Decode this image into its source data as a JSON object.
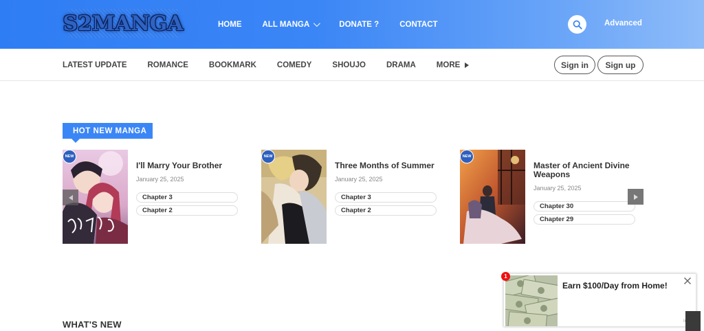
{
  "header": {
    "logo_text": "S2MANGA",
    "nav": [
      {
        "label": "HOME"
      },
      {
        "label": "ALL MANGA",
        "has_dropdown": true
      },
      {
        "label": "DONATE ?"
      },
      {
        "label": "CONTACT"
      }
    ],
    "advanced_label": "Advanced",
    "search_icon": "search-icon"
  },
  "subnav": {
    "items": [
      {
        "label": "LATEST UPDATE"
      },
      {
        "label": "ROMANCE"
      },
      {
        "label": "BOOKMARK"
      },
      {
        "label": "COMEDY"
      },
      {
        "label": "SHOUJO"
      },
      {
        "label": "DRAMA"
      },
      {
        "label": "MORE"
      }
    ],
    "signin_label": "Sign in",
    "signup_label": "Sign up"
  },
  "hot_new": {
    "heading": "HOT NEW MANGA",
    "badge_label": "NEW",
    "cards": [
      {
        "title": "I'll Marry Your Brother",
        "date": "January 25, 2025",
        "chapters": [
          "Chapter 3",
          "Chapter 2"
        ]
      },
      {
        "title": "Three Months of Summer",
        "date": "January 25, 2025",
        "chapters": [
          "Chapter 3",
          "Chapter 2"
        ]
      },
      {
        "title": "Master of Ancient Divine Weapons",
        "date": "January 25, 2025",
        "chapters": [
          "Chapter 30",
          "Chapter 29"
        ]
      }
    ]
  },
  "whats_new": {
    "heading": "WHAT'S NEW"
  },
  "ad": {
    "badge_count": "1",
    "text": "Earn $100/Day from Home!",
    "info_label": "Info"
  },
  "colors": {
    "brand_blue": "#3b86f6",
    "header_gradient_end": "#8fbcf9",
    "ad_badge": "#ee1111"
  }
}
